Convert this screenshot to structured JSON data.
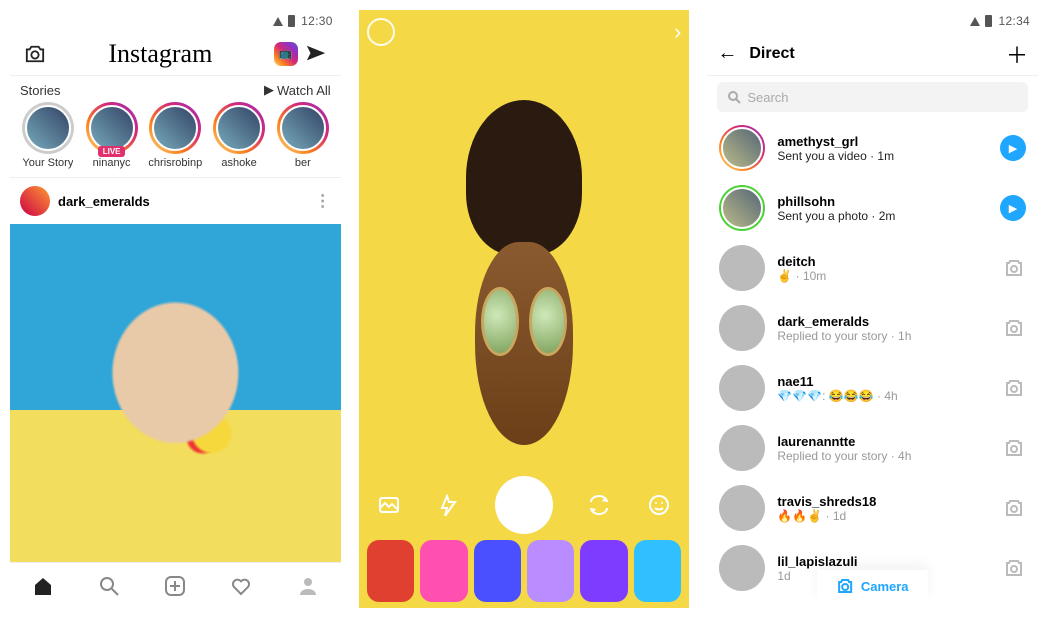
{
  "pane1": {
    "status_time": "12:30",
    "logo": "Instagram",
    "stories_label": "Stories",
    "watch_all": "Watch All",
    "stories": [
      {
        "name": "Your Story",
        "live": false
      },
      {
        "name": "ninanyc",
        "live": true,
        "live_label": "LIVE"
      },
      {
        "name": "chrisrobinp",
        "live": false
      },
      {
        "name": "ashoke",
        "live": false
      },
      {
        "name": "ber",
        "live": false
      }
    ],
    "post_user": "dark_emeralds"
  },
  "pane3": {
    "status_time": "12:34",
    "title": "Direct",
    "search_placeholder": "Search",
    "camera_label": "Camera",
    "messages": [
      {
        "user": "amethyst_grl",
        "sub": "Sent you a video",
        "time": "1m",
        "unread": true,
        "ring": "grad",
        "play": true
      },
      {
        "user": "phillsohn",
        "sub": "Sent you a photo",
        "time": "2m",
        "unread": true,
        "ring": "green",
        "play": true
      },
      {
        "user": "deitch",
        "sub": "✌️",
        "time": "10m",
        "unread": false,
        "ring": "",
        "play": false
      },
      {
        "user": "dark_emeralds",
        "sub": "Replied to your story",
        "time": "1h",
        "unread": false,
        "ring": "",
        "play": false
      },
      {
        "user": "nae11",
        "sub": "💎💎💎: 😂😂😂",
        "time": "4h",
        "unread": false,
        "ring": "",
        "play": false
      },
      {
        "user": "laurenanntte",
        "sub": "Replied to your story",
        "time": "4h",
        "unread": false,
        "ring": "",
        "play": false
      },
      {
        "user": "travis_shreds18",
        "sub": "🔥🔥✌️",
        "time": "1d",
        "unread": false,
        "ring": "",
        "play": false
      },
      {
        "user": "lil_lapislazuli",
        "sub": "",
        "time": "1d",
        "unread": false,
        "ring": "",
        "play": false
      }
    ]
  },
  "filter_colors": [
    "#e04030",
    "#ff4fb0",
    "#4a4fff",
    "#b98cff",
    "#7d3cff",
    "#30c0ff"
  ]
}
